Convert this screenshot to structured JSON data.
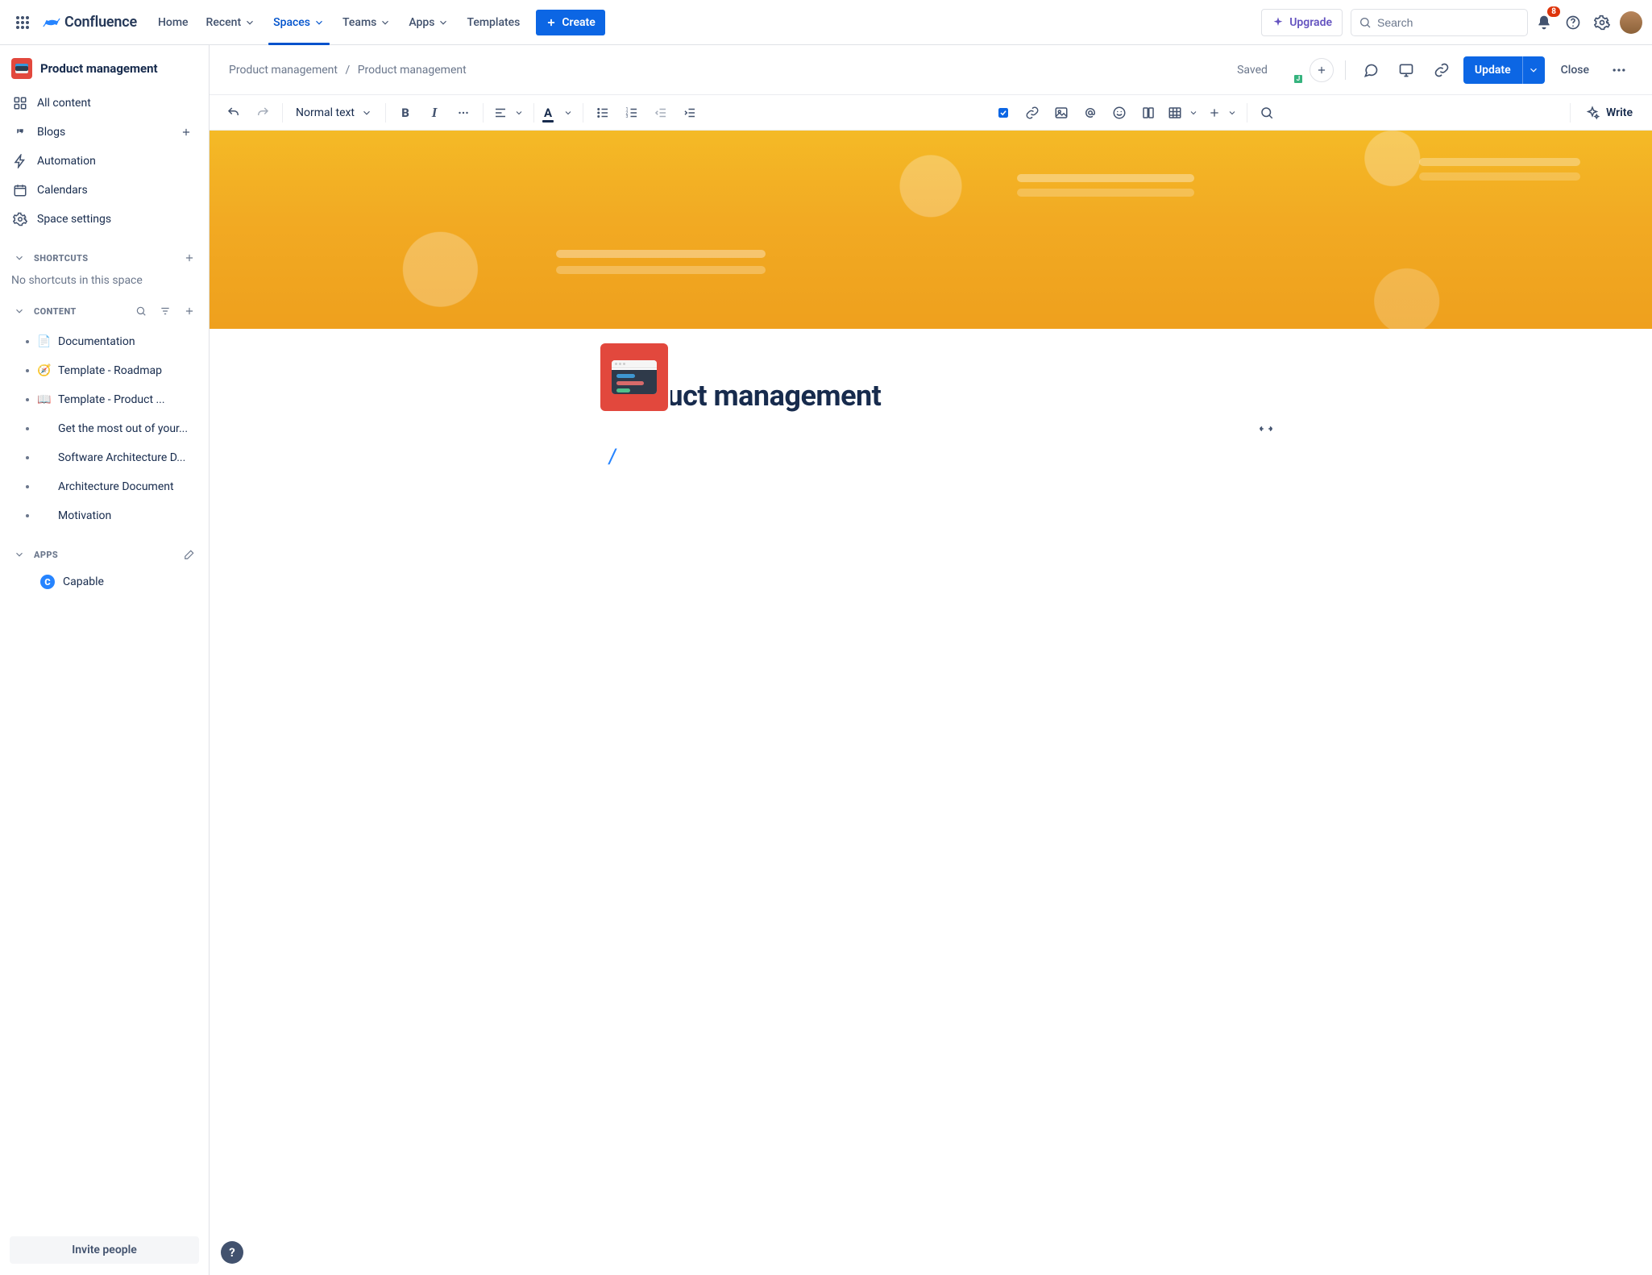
{
  "topnav": {
    "brand": "Confluence",
    "items": [
      {
        "label": "Home",
        "has_chevron": false,
        "active": false
      },
      {
        "label": "Recent",
        "has_chevron": true,
        "active": false
      },
      {
        "label": "Spaces",
        "has_chevron": true,
        "active": true
      },
      {
        "label": "Teams",
        "has_chevron": true,
        "active": false
      },
      {
        "label": "Apps",
        "has_chevron": true,
        "active": false
      },
      {
        "label": "Templates",
        "has_chevron": false,
        "active": false
      }
    ],
    "create_label": "Create",
    "upgrade_label": "Upgrade",
    "search_placeholder": "Search",
    "notification_count": "8"
  },
  "sidebar": {
    "space_name": "Product management",
    "primary": [
      {
        "icon": "grid",
        "label": "All content"
      },
      {
        "icon": "quotes",
        "label": "Blogs"
      },
      {
        "icon": "bolt",
        "label": "Automation"
      },
      {
        "icon": "calendar",
        "label": "Calendars"
      },
      {
        "icon": "gear",
        "label": "Space settings"
      }
    ],
    "shortcuts_heading": "Shortcuts",
    "shortcuts_empty": "No shortcuts in this space",
    "content_heading": "Content",
    "pages": [
      {
        "emoji": "📄",
        "label": "Documentation"
      },
      {
        "emoji": "🧭",
        "label": "Template - Roadmap"
      },
      {
        "emoji": "📖",
        "label": "Template - Product ..."
      },
      {
        "emoji": "",
        "label": "Get the most out of your..."
      },
      {
        "emoji": "",
        "label": "Software Architecture D..."
      },
      {
        "emoji": "",
        "label": "Architecture Document"
      },
      {
        "emoji": "",
        "label": "Motivation"
      }
    ],
    "apps_heading": "Apps",
    "apps": [
      {
        "label": "Capable"
      }
    ],
    "invite_label": "Invite people"
  },
  "page_header": {
    "breadcrumb": [
      "Product management",
      "Product management"
    ],
    "saved_label": "Saved",
    "update_label": "Update",
    "close_label": "Close"
  },
  "toolbar": {
    "text_style_label": "Normal text",
    "write_label": "Write"
  },
  "editor": {
    "title": "Product management",
    "body_content": "/"
  }
}
